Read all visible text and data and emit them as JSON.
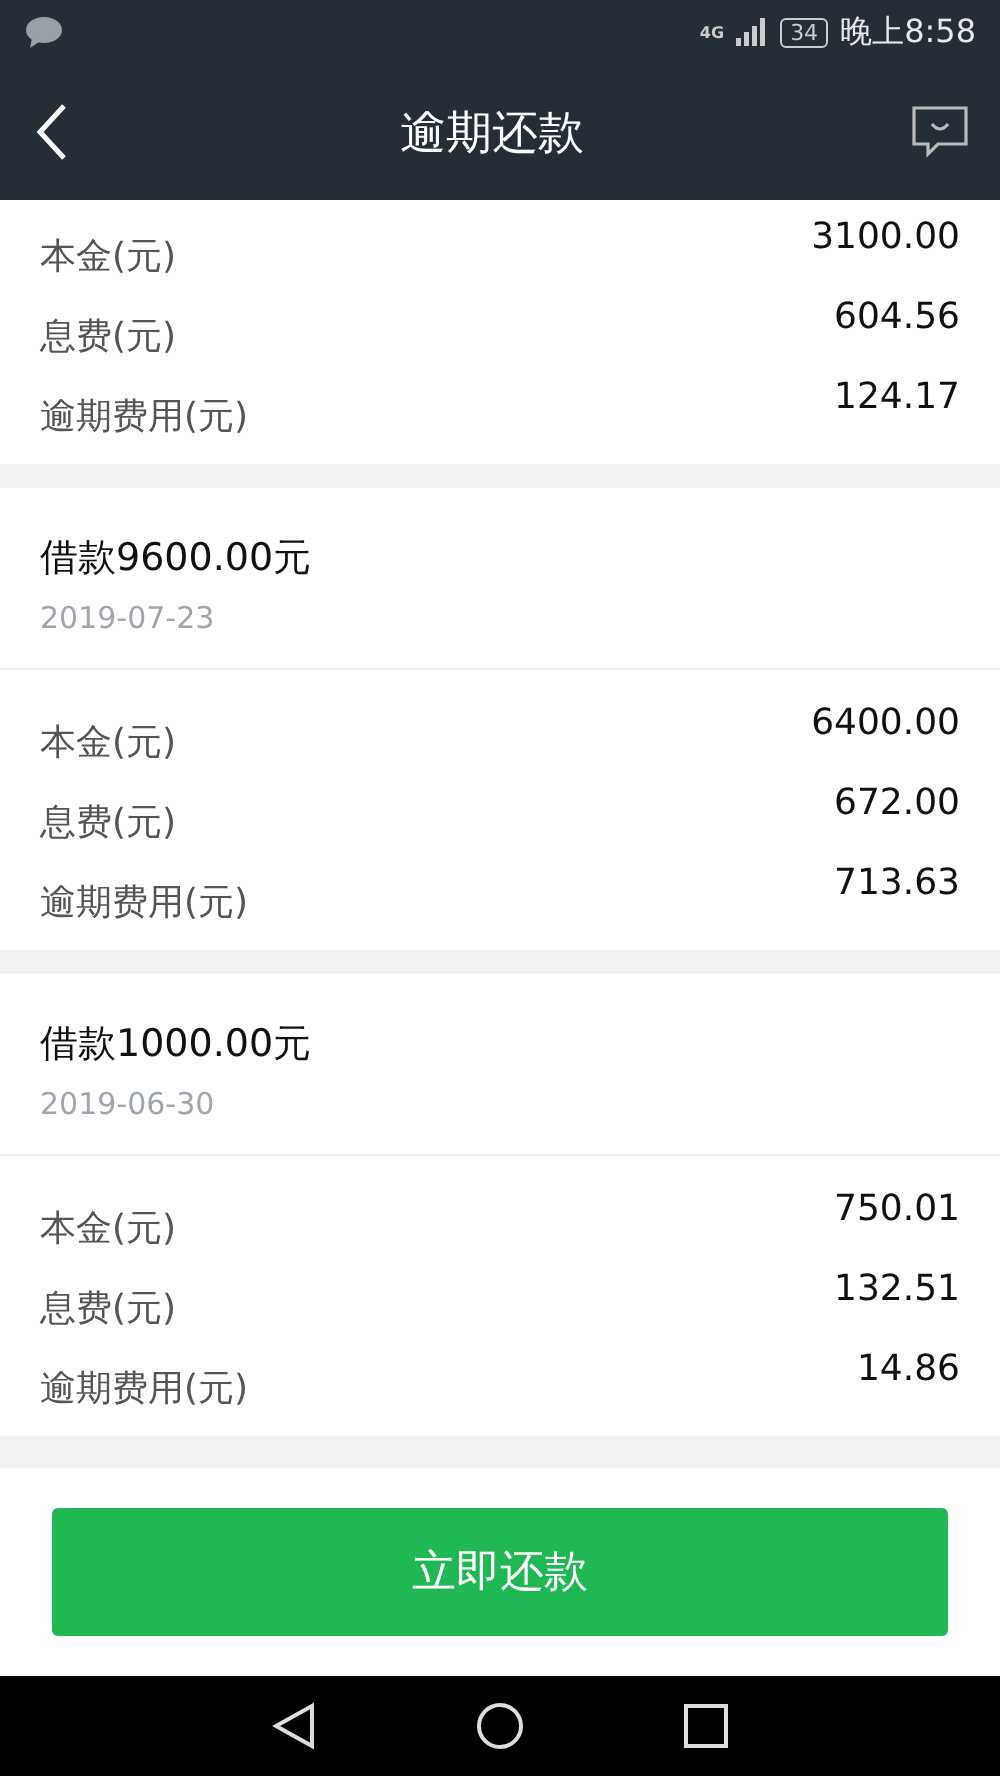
{
  "status_bar": {
    "network": "4G",
    "battery": "34",
    "time": "晚上8:58"
  },
  "header": {
    "title": "逾期还款"
  },
  "loans": [
    {
      "rows": [
        {
          "label": "本金(元)",
          "value": "3100.00"
        },
        {
          "label": "息费(元)",
          "value": "604.56"
        },
        {
          "label": "逾期费用(元)",
          "value": "124.17"
        }
      ]
    },
    {
      "title": "借款9600.00元",
      "date": "2019-07-23",
      "rows": [
        {
          "label": "本金(元)",
          "value": "6400.00"
        },
        {
          "label": "息费(元)",
          "value": "672.00"
        },
        {
          "label": "逾期费用(元)",
          "value": "713.63"
        }
      ]
    },
    {
      "title": "借款1000.00元",
      "date": "2019-06-30",
      "rows": [
        {
          "label": "本金(元)",
          "value": "750.01"
        },
        {
          "label": "息费(元)",
          "value": "132.51"
        },
        {
          "label": "逾期费用(元)",
          "value": "14.86"
        }
      ]
    }
  ],
  "action_button": "立即还款"
}
